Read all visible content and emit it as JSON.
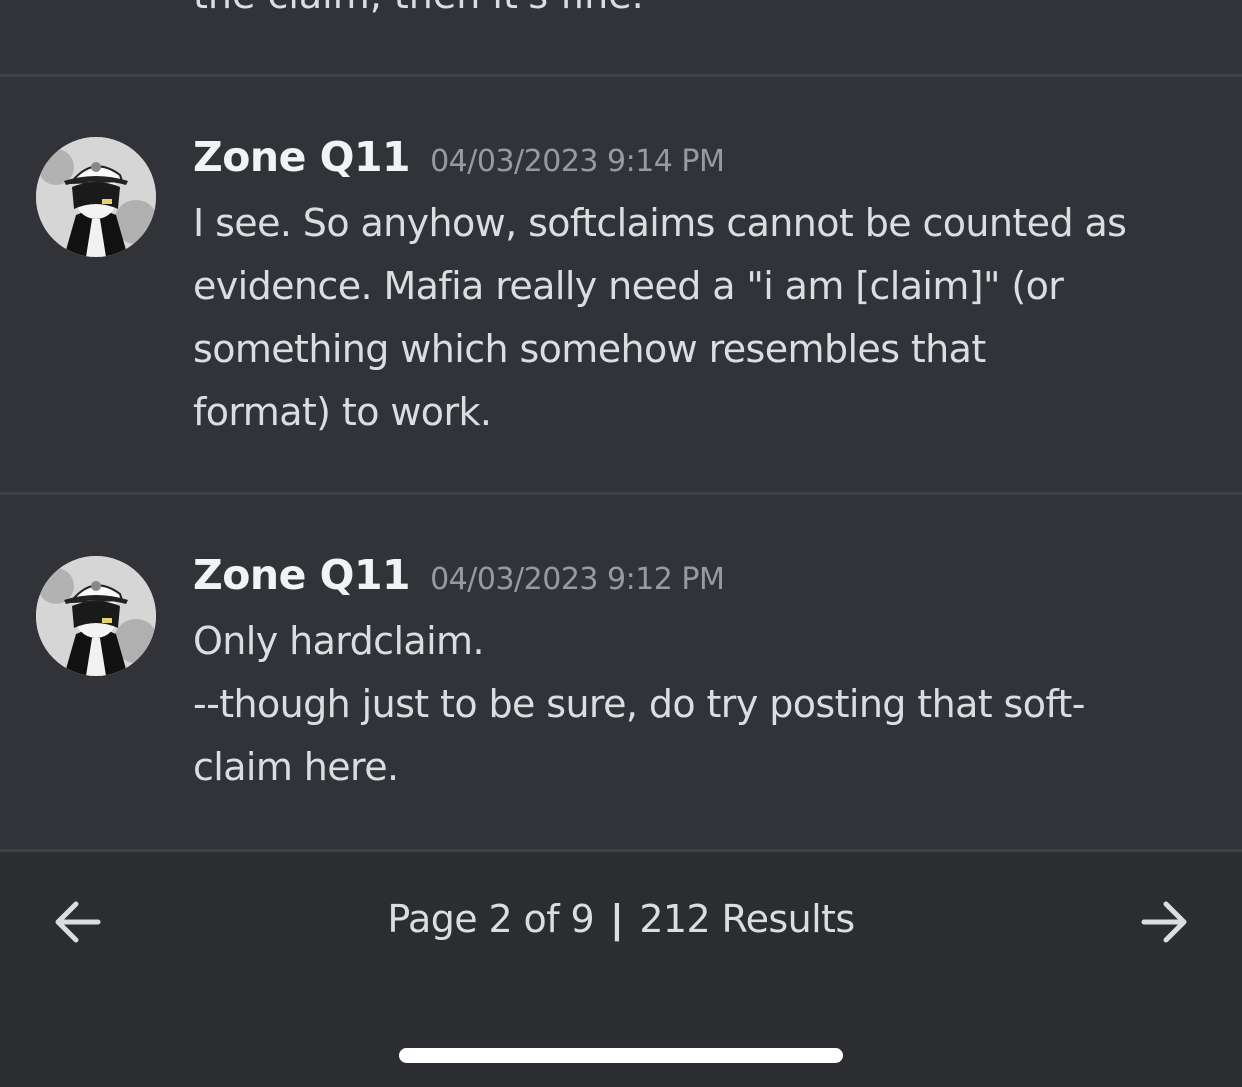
{
  "previous_message_tail": "the claim, then it's fine.",
  "messages": [
    {
      "username": "Zone Q11",
      "timestamp": "04/03/2023 9:14 PM",
      "lines": [
        "I see. So anyhow, softclaims cannot be counted as",
        "evidence. Mafia really need a \"i am [claim]\" (or",
        "something which somehow resembles that",
        "format) to work."
      ]
    },
    {
      "username": "Zone Q11",
      "timestamp": "04/03/2023 9:12 PM",
      "lines": [
        "Only hardclaim.",
        "--though just to be sure, do try posting that soft-",
        "claim here."
      ]
    }
  ],
  "pagination": {
    "page_text": "Page 2 of 9",
    "separator": "|",
    "results_text": "212 Results",
    "prev_icon": "arrow-left-icon",
    "next_icon": "arrow-right-icon"
  },
  "colors": {
    "results_background": "#313338",
    "footer_background": "#2b2d31",
    "divider": "#3f4147",
    "username": "#f2f3f5",
    "timestamp": "#949ba4",
    "text": "#dbdee1"
  }
}
